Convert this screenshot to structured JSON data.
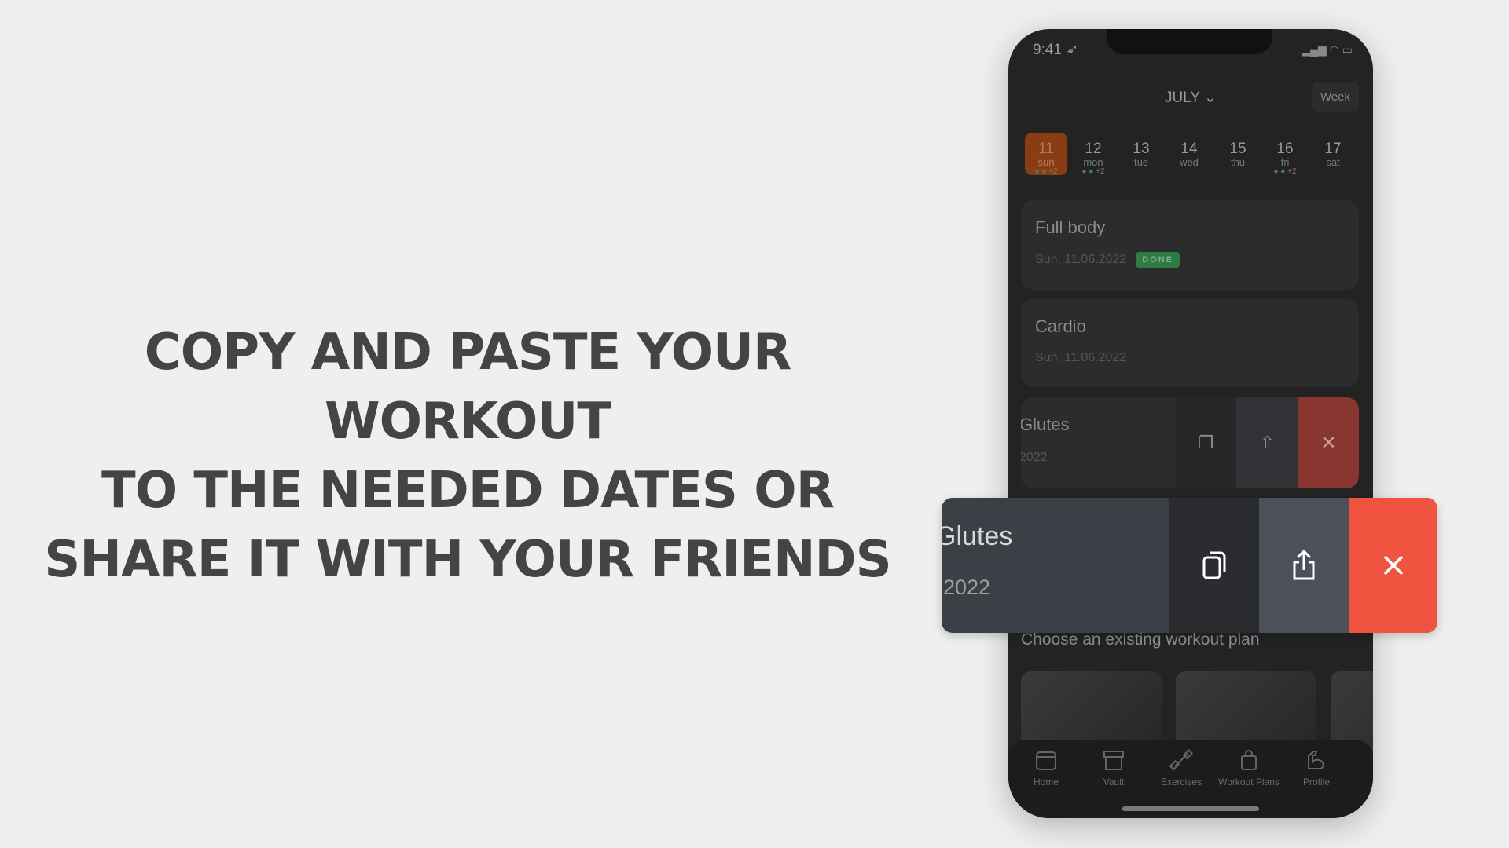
{
  "headline": {
    "lines": [
      "COPY AND PASTE YOUR WORKOUT",
      "TO THE NEEDED DATES OR",
      "SHARE IT WITH YOUR FRIENDS"
    ]
  },
  "status": {
    "time": "9:41"
  },
  "header": {
    "month": "JULY",
    "view_toggle": "Week"
  },
  "days": [
    {
      "num": "11",
      "wd": "sun",
      "extra": "+2",
      "dots": true,
      "selected": true
    },
    {
      "num": "12",
      "wd": "mon",
      "extra": "+2",
      "dots": true
    },
    {
      "num": "13",
      "wd": "tue"
    },
    {
      "num": "14",
      "wd": "wed"
    },
    {
      "num": "15",
      "wd": "thu"
    },
    {
      "num": "16",
      "wd": "fri",
      "extra": "+2",
      "dots": true
    },
    {
      "num": "17",
      "wd": "sat"
    }
  ],
  "workouts": [
    {
      "title": "Full body",
      "date": "Sun, 11.06.2022",
      "badge": "DONE"
    },
    {
      "title": "Cardio",
      "date": "Sun, 11.06.2022"
    },
    {
      "title": "Glutes",
      "date": "2022"
    }
  ],
  "swipe_preview": {
    "title": "Glutes",
    "date": "2022"
  },
  "section": {
    "choose": "Choose an existing workout plan"
  },
  "tabs": [
    "Home",
    "Vault",
    "Exercises",
    "Workout Plans",
    "Profile"
  ],
  "colors": {
    "accent": "#8a3c15",
    "delete": "#f0533f",
    "done": "#2f7a45"
  }
}
